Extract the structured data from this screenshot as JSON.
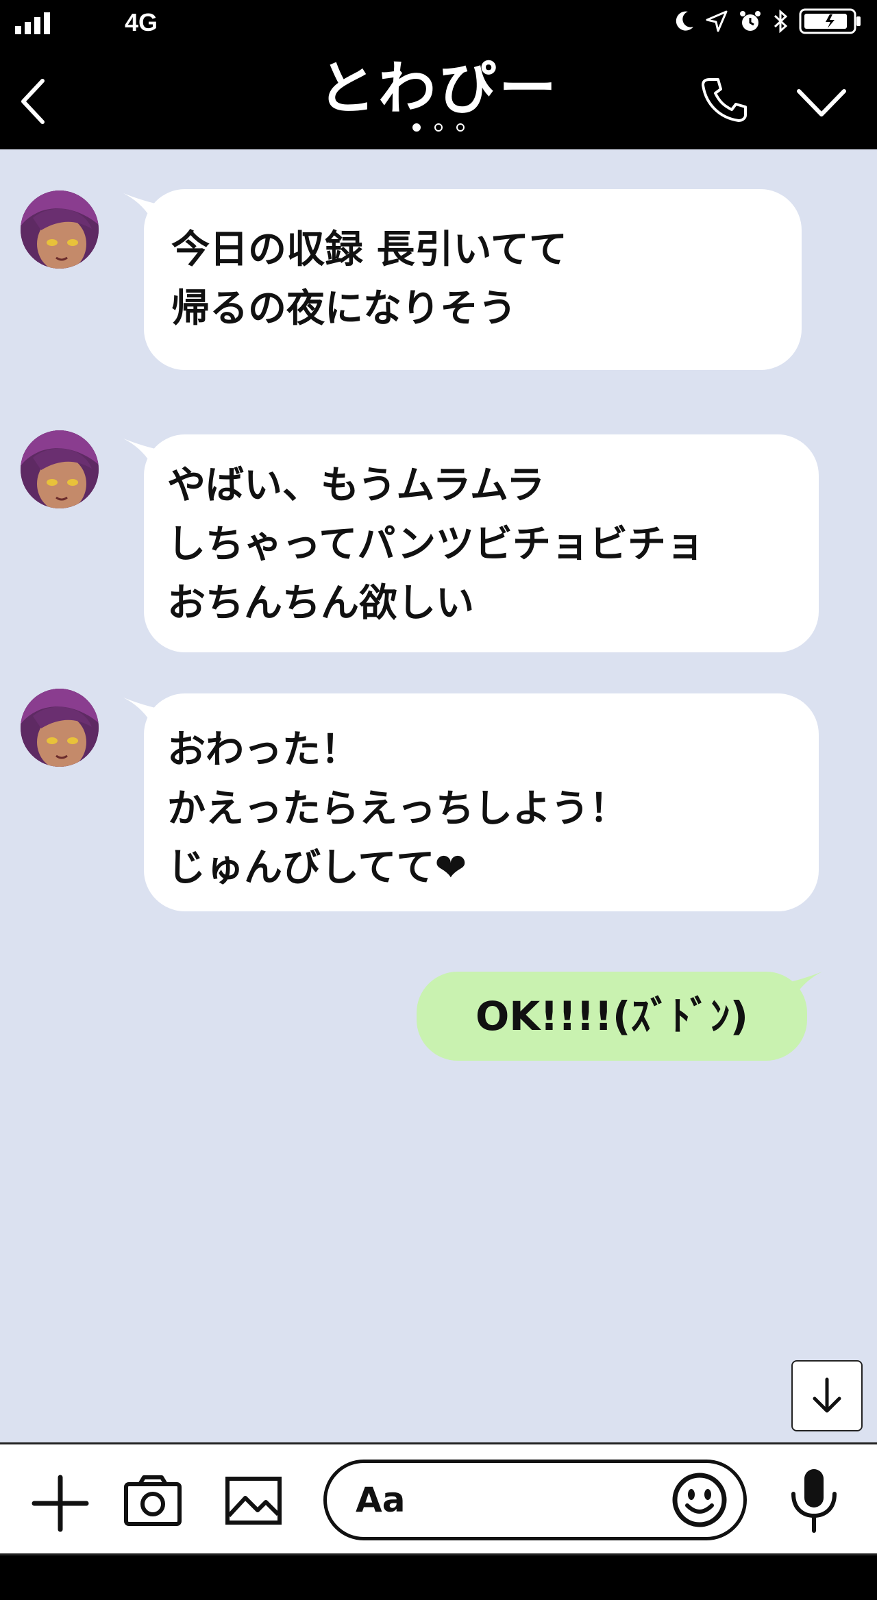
{
  "status_bar": {
    "carrier": "4G",
    "icons": [
      "signal-icon",
      "moon-icon",
      "location-icon",
      "alarm-icon",
      "bluetooth-icon",
      "battery-icon"
    ]
  },
  "header": {
    "title": "とわぴー",
    "page_dots": 3,
    "active_page": 1,
    "icons": [
      "back-chevron-icon",
      "phone-icon",
      "chevron-down-icon"
    ]
  },
  "messages": [
    {
      "sender": "other",
      "text": "今日の収録 長引いてて\n帰るの夜になりそう"
    },
    {
      "sender": "other",
      "text": "やばい、もうムラムラ\nしちゃってパンツビチョビチョ\nおちんちん欲しい"
    },
    {
      "sender": "other",
      "text": "おわった！\nかえったらえっちしよう！\nじゅんびしてて❤"
    },
    {
      "sender": "me",
      "text": "OK!!!!(ｽﾞﾄﾞﾝ)"
    }
  ],
  "input_bar": {
    "placeholder": "Aa",
    "icons": [
      "plus-icon",
      "camera-icon",
      "image-icon",
      "smiley-icon",
      "microphone-icon"
    ]
  },
  "colors": {
    "chat_background": "#dbe1f0",
    "header": "#000000",
    "incoming_bubble": "#ffffff",
    "outgoing_bubble": "#c9f2b0"
  }
}
